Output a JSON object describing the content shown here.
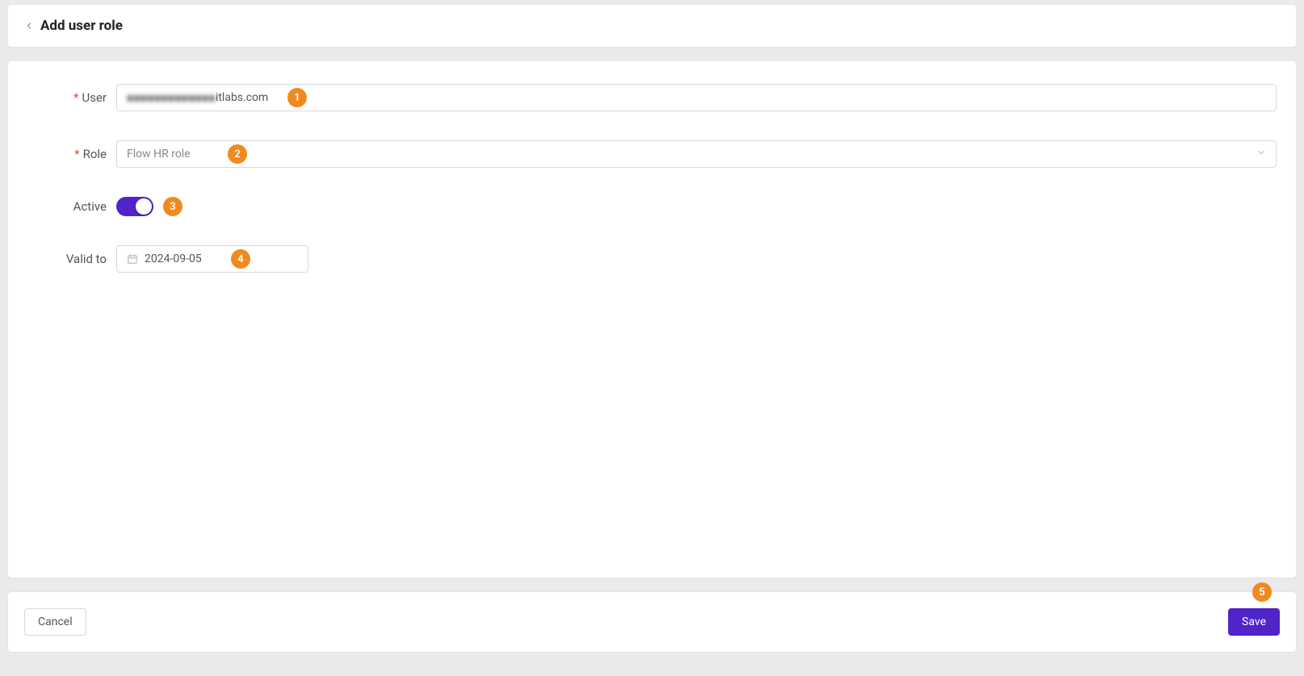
{
  "header": {
    "title": "Add user role"
  },
  "form": {
    "user": {
      "label": "User",
      "value_masked": "■■■■■■■■■■■■■",
      "value_suffix": "itlabs.com",
      "required": true
    },
    "role": {
      "label": "Role",
      "placeholder": "Flow HR role",
      "required": true
    },
    "active": {
      "label": "Active",
      "value": true
    },
    "valid_to": {
      "label": "Valid to",
      "value": "2024-09-05"
    }
  },
  "footer": {
    "cancel": "Cancel",
    "save": "Save"
  },
  "annotations": {
    "m1": "1",
    "m2": "2",
    "m3": "3",
    "m4": "4",
    "m5": "5"
  },
  "colors": {
    "accent": "#4f24c9",
    "annotation": "#f08a1f",
    "required": "#e64b3b"
  }
}
